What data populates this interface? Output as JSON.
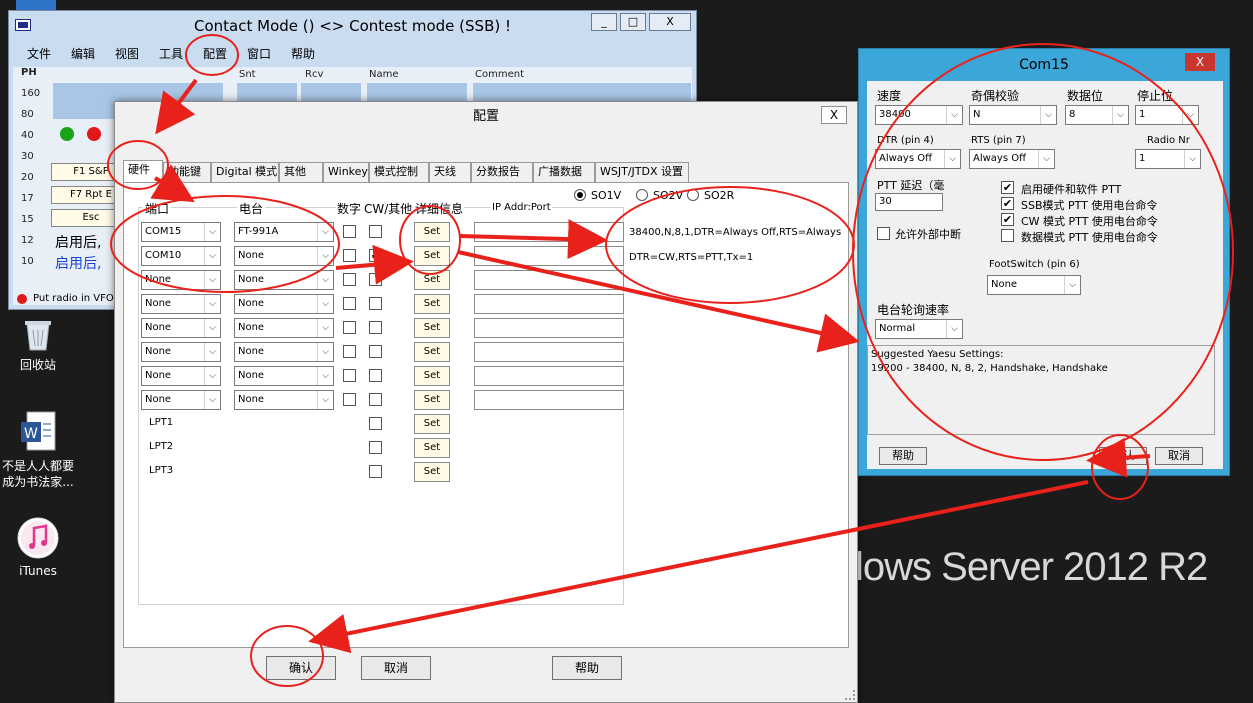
{
  "desktop": {
    "recycle_bin": "回收站",
    "word_doc": "不是人人都要\n成为书法家...",
    "itunes": "iTunes",
    "watermark": "lows Server 2012 R2"
  },
  "main_window": {
    "title": "Contact Mode () <> Contest mode (SSB) !",
    "menu": [
      "文件",
      "编辑",
      "视图",
      "工具",
      "配置",
      "窗口",
      "帮助"
    ],
    "ph_label": "PH",
    "ph_values": [
      "160",
      "80",
      "40",
      "30",
      "20",
      "17",
      "15",
      "12",
      "10"
    ],
    "field_headers": [
      "Snt",
      "Rcv",
      "Name",
      "Comment"
    ],
    "fkeys": [
      "F1 S&P",
      "F7 Rpt E",
      "Esc"
    ],
    "line1": "启用后,",
    "line2": "启用后,",
    "status": "Put radio in VFO",
    "controls": [
      "_",
      "□",
      "X"
    ],
    "led_colors": [
      "#19a319",
      "#e01818"
    ]
  },
  "config_dialog": {
    "title": "配置",
    "close": "X",
    "tabs": [
      "硬件",
      "功能键",
      "Digital 模式",
      "其他",
      "Winkey",
      "模式控制",
      "天线",
      "分数报告",
      "广播数据",
      "WSJT/JTDX 设置"
    ],
    "so_options": [
      {
        "label": "SO1V",
        "selected": true
      },
      {
        "label": "SO2V",
        "selected": false
      },
      {
        "label": "SO2R",
        "selected": false
      }
    ],
    "headers": {
      "port": "端口",
      "radio": "电台",
      "digital": "数字",
      "cw": "CW/其他",
      "details": "详细信息",
      "ip": "IP Addr:Port"
    },
    "rows": [
      {
        "port": "COM15",
        "radio": "FT-991A",
        "digital": false,
        "cw": false,
        "set": "Set",
        "info": "38400,N,8,1,DTR=Always Off,RTS=Always"
      },
      {
        "port": "COM10",
        "radio": "None",
        "digital": false,
        "cw": true,
        "set": "Set",
        "info": "DTR=CW,RTS=PTT,Tx=1"
      },
      {
        "port": "None",
        "radio": "None",
        "digital": false,
        "cw": false,
        "set": "Set"
      },
      {
        "port": "None",
        "radio": "None",
        "digital": false,
        "cw": false,
        "set": "Set"
      },
      {
        "port": "None",
        "radio": "None",
        "digital": false,
        "cw": false,
        "set": "Set"
      },
      {
        "port": "None",
        "radio": "None",
        "digital": false,
        "cw": false,
        "set": "Set"
      },
      {
        "port": "None",
        "radio": "None",
        "digital": false,
        "cw": false,
        "set": "Set"
      },
      {
        "port": "None",
        "radio": "None",
        "digital": false,
        "cw": false,
        "set": "Set"
      }
    ],
    "lpt_rows": [
      {
        "label": "LPT1",
        "set": "Set"
      },
      {
        "label": "LPT2",
        "set": "Set"
      },
      {
        "label": "LPT3",
        "set": "Set"
      }
    ],
    "ok": "确认",
    "cancel": "取消",
    "help": "帮助"
  },
  "com_dialog": {
    "title": "Com15",
    "close": "X",
    "speed_label": "速度",
    "speed_value": "38400",
    "parity_label": "奇偶校验",
    "parity_value": "N",
    "databits_label": "数据位",
    "databits_value": "8",
    "stopbits_label": "停止位",
    "stopbits_value": "1",
    "dtr_label": "DTR (pin 4)",
    "dtr_value": "Always Off",
    "rts_label": "RTS (pin 7)",
    "rts_value": "Always Off",
    "radionr_label": "Radio Nr",
    "radionr_value": "1",
    "ptt_delay_label": "PTT 延迟（毫",
    "ptt_delay_value": "30",
    "checks": [
      {
        "label": "启用硬件和软件 PTT",
        "checked": true
      },
      {
        "label": "SSB模式 PTT 使用电台命令",
        "checked": true
      },
      {
        "label": "CW 模式 PTT 使用电台命令",
        "checked": true
      },
      {
        "label": "数据模式 PTT 使用电台命令",
        "checked": false
      }
    ],
    "ext_interrupt": {
      "label": "允许外部中断",
      "checked": false
    },
    "footswitch_label": "FootSwitch (pin 6)",
    "footswitch_value": "None",
    "poll_label": "电台轮询速率",
    "poll_value": "Normal",
    "memo_line1": "Suggested Yaesu Settings:",
    "memo_line2": "19200 - 38400, N, 8, 2, Handshake, Handshake",
    "help": "帮助",
    "ok": "确认",
    "cancel": "取消"
  },
  "annotation_color": "#e8221b"
}
